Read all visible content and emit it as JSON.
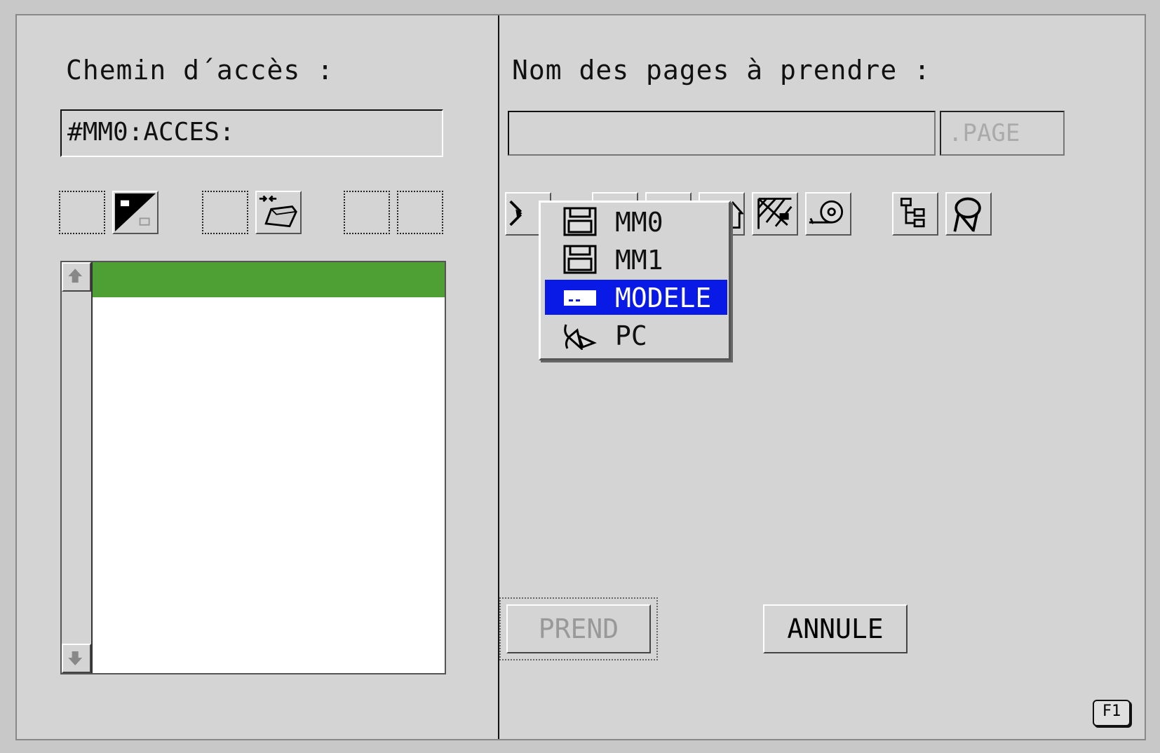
{
  "left": {
    "path_label": "Chemin d´accès :",
    "path_value": "#MM0:ACCES:"
  },
  "right": {
    "pages_label": "Nom des pages à prendre :",
    "pages_value": "",
    "extension": ".PAGE"
  },
  "drive_menu": {
    "items": [
      {
        "label": "MM0",
        "icon": "floppy-disk-icon"
      },
      {
        "label": "MM1",
        "icon": "floppy-disk-icon"
      },
      {
        "label": "MODELE",
        "icon": "ram-disk-icon",
        "selected": true
      },
      {
        "label": "PC",
        "icon": "network-icon"
      }
    ]
  },
  "buttons": {
    "take": "PREND",
    "cancel": "ANNULE",
    "help": "F1"
  },
  "colors": {
    "selection_green": "#4ea035",
    "menu_highlight": "#0a1ae6"
  }
}
